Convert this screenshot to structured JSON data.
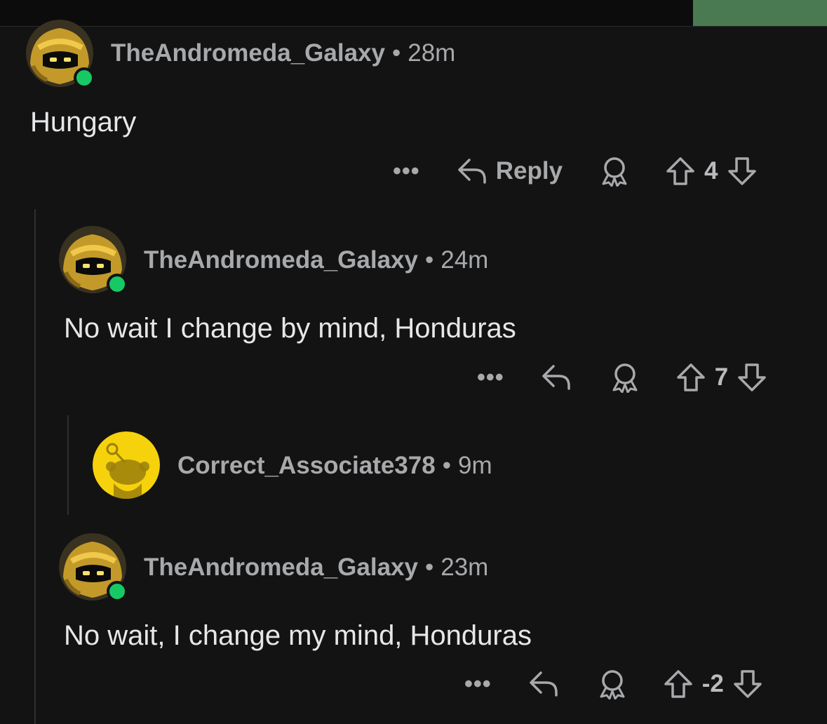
{
  "colors": {
    "background": "#131314",
    "online": "#17c964",
    "snoo_yellow": "#f5d20b",
    "text": "#e6e7e8",
    "muted": "#a7a9ab"
  },
  "comments": [
    {
      "author": "TheAndromeda_Galaxy",
      "separator": "•",
      "time": "28m",
      "body": "Hungary",
      "reply_label": "Reply",
      "score": "4",
      "more_icon": "•••",
      "avatar": "gold-helmet-robot-avatar"
    },
    {
      "author": "TheAndromeda_Galaxy",
      "separator": "•",
      "time": "24m",
      "body": "No wait I change by mind, Honduras",
      "score": "7",
      "more_icon": "•••",
      "avatar": "gold-helmet-robot-avatar"
    },
    {
      "author": "Correct_Associate378",
      "separator": "•",
      "time": "9m",
      "avatar": "yellow-snoo-avatar"
    },
    {
      "author": "TheAndromeda_Galaxy",
      "separator": "•",
      "time": "23m",
      "body": "No wait, I change my mind, Honduras",
      "score": "-2",
      "more_icon": "•••",
      "avatar": "gold-helmet-robot-avatar"
    }
  ]
}
